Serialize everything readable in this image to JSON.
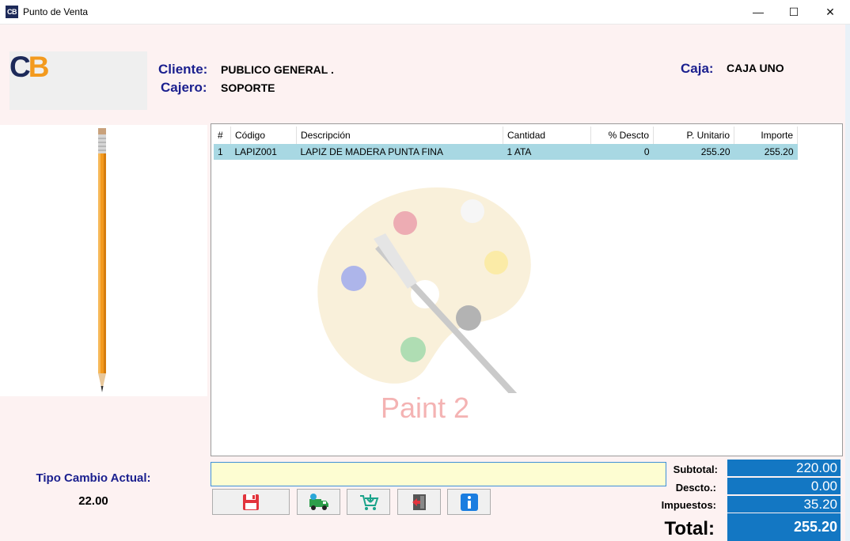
{
  "window": {
    "title": "Punto de Venta",
    "icon_text": "CB",
    "minimize_glyph": "—",
    "maximize_glyph": "☐",
    "close_glyph": "✕"
  },
  "logo": {
    "c": "C",
    "b": "B"
  },
  "header": {
    "cliente_label": "Cliente:",
    "cliente_value": "PUBLICO GENERAL .",
    "cajero_label": "Cajero:",
    "cajero_value": "SOPORTE",
    "caja_label": "Caja:",
    "caja_value": "CAJA UNO"
  },
  "table": {
    "columns": [
      "#",
      "Código",
      "Descripción",
      "Cantidad",
      "% Descto",
      "P. Unitario",
      "Importe"
    ],
    "rows": [
      [
        "1",
        "LAPIZ001",
        "LAPIZ DE MADERA PUNTA FINA",
        "1 ATA",
        "0",
        "255.20",
        "255.20"
      ]
    ],
    "watermark_text": "Paint 2"
  },
  "input": {
    "value": ""
  },
  "toolbar": {
    "icons": [
      "save-icon",
      "delivery-truck-icon",
      "shopping-cart-icon",
      "exit-door-icon",
      "info-icon"
    ]
  },
  "exchange": {
    "label": "Tipo Cambio Actual:",
    "value": "22.00"
  },
  "totals": {
    "subtotal_label": "Subtotal:",
    "subtotal_value": "220.00",
    "descto_label": "Descto.:",
    "descto_value": "0.00",
    "impuestos_label": "Impuestos:",
    "impuestos_value": "35.20",
    "total_label": "Total:",
    "total_value": "255.20"
  },
  "colors": {
    "label_blue": "#1a1f8e",
    "brand_navy": "#1d2a59",
    "brand_orange": "#f39a1e",
    "total_box": "#1377c3",
    "row_selected": "#a8d8e3",
    "input_bg": "#fdfdd2",
    "app_bg": "#fdf2f2"
  }
}
